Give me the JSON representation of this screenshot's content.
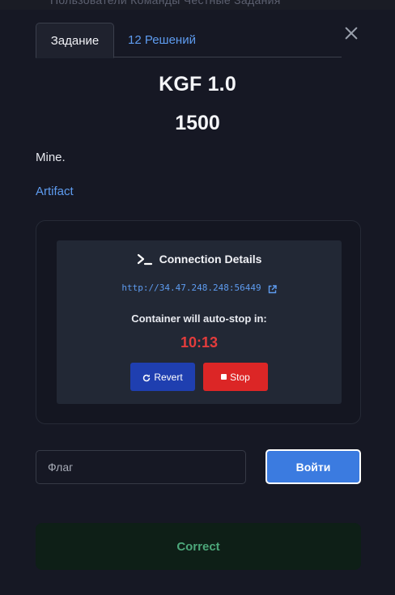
{
  "background_nav": {
    "text": "Пользователи Команды Честные Задания"
  },
  "tabs": [
    {
      "label": "Задание",
      "active": true
    },
    {
      "label": "12 Решений",
      "active": false
    }
  ],
  "challenge": {
    "title": "KGF 1.0",
    "points": "1500",
    "description": "Mine.",
    "artifact_link": "Artifact"
  },
  "connection": {
    "title": "Connection Details",
    "url": "http://34.47.248.248:56449",
    "auto_stop_label": "Container will auto-stop in:",
    "timer": "10:13",
    "revert_label": "Revert",
    "stop_label": "Stop"
  },
  "flag_form": {
    "placeholder": "Флаг",
    "value": "",
    "submit_label": "Войти"
  },
  "result": {
    "message": "Correct"
  },
  "colors": {
    "accent_blue": "#5e9cf0",
    "revert_button": "#1f3fb0",
    "stop_button": "#dc2626",
    "timer": "#e43c3c",
    "correct_text": "#4ca77a",
    "correct_bg": "#0e1f17"
  },
  "icons": [
    "close-icon",
    "terminal-icon",
    "external-link-icon",
    "revert-icon",
    "stop-icon"
  ]
}
